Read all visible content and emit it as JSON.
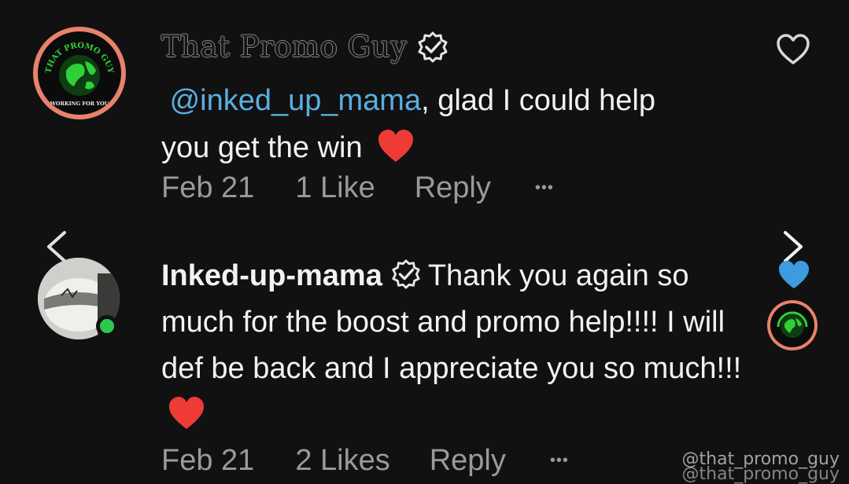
{
  "comments": [
    {
      "author": "That Promo Guy",
      "verified": true,
      "mention": "@inked_up_mama",
      "text_line1": ", glad I could help",
      "text_line2": "you get the win",
      "emoji": "❤️",
      "date": "Feb 21",
      "likes": "1 Like",
      "reply_label": "Reply",
      "more_label": "•••",
      "liked": false,
      "avatar": {
        "top_text": "THAT PROMO GUY",
        "bottom_text": "WORKING FOR YOU"
      }
    },
    {
      "author": "Inked-up-mama",
      "verified": true,
      "text": "Thank you again so much for the boost and promo help!!!! I will def be back and I appreciate you so much!!!",
      "emoji": "❤️",
      "date": "Feb 21",
      "likes": "2 Likes",
      "reply_label": "Reply",
      "more_label": "•••",
      "liked": true,
      "online": true
    }
  ],
  "colors": {
    "background": "#111111",
    "mention": "#5aaee0",
    "liked_heart": "#3d9be0",
    "online": "#2cc84f",
    "avatar_ring": "#e8826c",
    "meta_text": "#9a9a9a"
  },
  "icons": {
    "verified": "verified-badge-icon",
    "like_outline": "heart-outline-icon",
    "like_filled": "heart-filled-icon",
    "prev": "chevron-left-icon",
    "next": "chevron-right-icon"
  },
  "watermark": {
    "line1": "@that_promo_guy",
    "line2": "@that_promo_guy"
  }
}
